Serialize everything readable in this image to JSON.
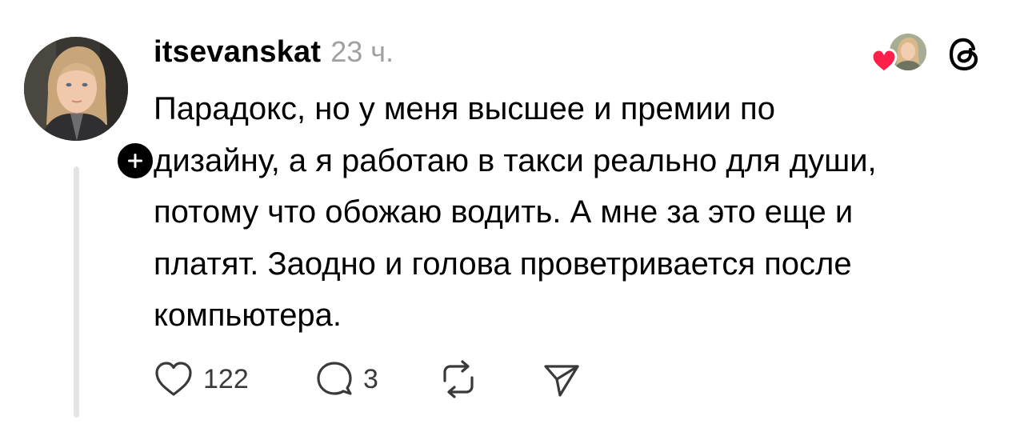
{
  "post": {
    "username": "itsevanskat",
    "timestamp": "23 ч.",
    "text": "Парадокс, но у меня высшее и премии по\nдизайну, а я работаю в такси реально для души,\nпотому что обожаю водить. А мне за это еще и\nплатят. Заодно и голова проветривается после\nкомпьютера.",
    "likes": "122",
    "replies": "3"
  },
  "icons": {
    "avatar": "user-avatar-photo",
    "follow": "plus-icon",
    "liked_by": "heart-icon",
    "app": "threads-logo-icon",
    "like": "heart-outline-icon",
    "reply": "speech-bubble-icon",
    "repost": "repost-icon",
    "share": "paper-plane-icon"
  },
  "colors": {
    "text": "#000000",
    "timestamp": "#a0a0a0",
    "heart": "#ff1f4b",
    "thread_line": "#e4e4e4",
    "badge": "#000000"
  }
}
